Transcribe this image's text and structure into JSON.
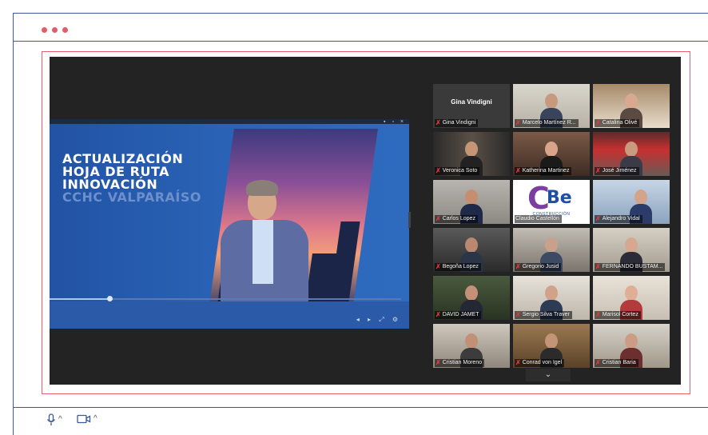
{
  "window": {
    "dot_colors": [
      "#e45c6a",
      "#e45c6a",
      "#e45c6a"
    ],
    "border_color": "#3c5a9a",
    "viewport_border_color": "#e8616c"
  },
  "toolbar": {
    "mic_icon": "microphone-icon",
    "camera_icon": "video-camera-icon",
    "mic_caret": "^",
    "camera_caret": "^"
  },
  "shared_screen": {
    "title_lines": [
      "ACTUALIZACIÓN",
      "HOJA DE RUTA",
      "INNOVACIÓN",
      "CCHC VALPARAÍSO"
    ],
    "progress": 0.17
  },
  "gallery": {
    "featured": {
      "label": "Gina Vindigni"
    },
    "participants": [
      {
        "name": "Gina Vindigni",
        "muted": true
      },
      {
        "name": "Marcelo Martínez R...",
        "muted": true
      },
      {
        "name": "Catalina Olivé",
        "muted": true,
        "active_speaker": true
      },
      {
        "name": "Veronica Soto",
        "muted": true
      },
      {
        "name": "Katherina Martinez",
        "muted": true
      },
      {
        "name": "José Jiménez",
        "muted": true
      },
      {
        "name": "Carlos Lopez",
        "muted": true
      },
      {
        "name": "Claudio Castellón",
        "muted": false
      },
      {
        "name": "Alejandro Vidal",
        "muted": true
      },
      {
        "name": "Begoña Lopez",
        "muted": true
      },
      {
        "name": "Gregorio Jusid",
        "muted": true
      },
      {
        "name": "FERNANDO BUSTAM...",
        "muted": true
      },
      {
        "name": "DAVID JAMET",
        "muted": true
      },
      {
        "name": "Sergio Silva Traver",
        "muted": true
      },
      {
        "name": "Marisol Cortez",
        "muted": true
      },
      {
        "name": "Cristian Moreno",
        "muted": true
      },
      {
        "name": "Conrad von Igel",
        "muted": true
      },
      {
        "name": "Cristian Baria",
        "muted": true
      }
    ],
    "logo_tile": {
      "c": "C",
      "be": "Be",
      "subtitle": "CONSTRUCCIÓN"
    },
    "more_label": "⌄"
  }
}
